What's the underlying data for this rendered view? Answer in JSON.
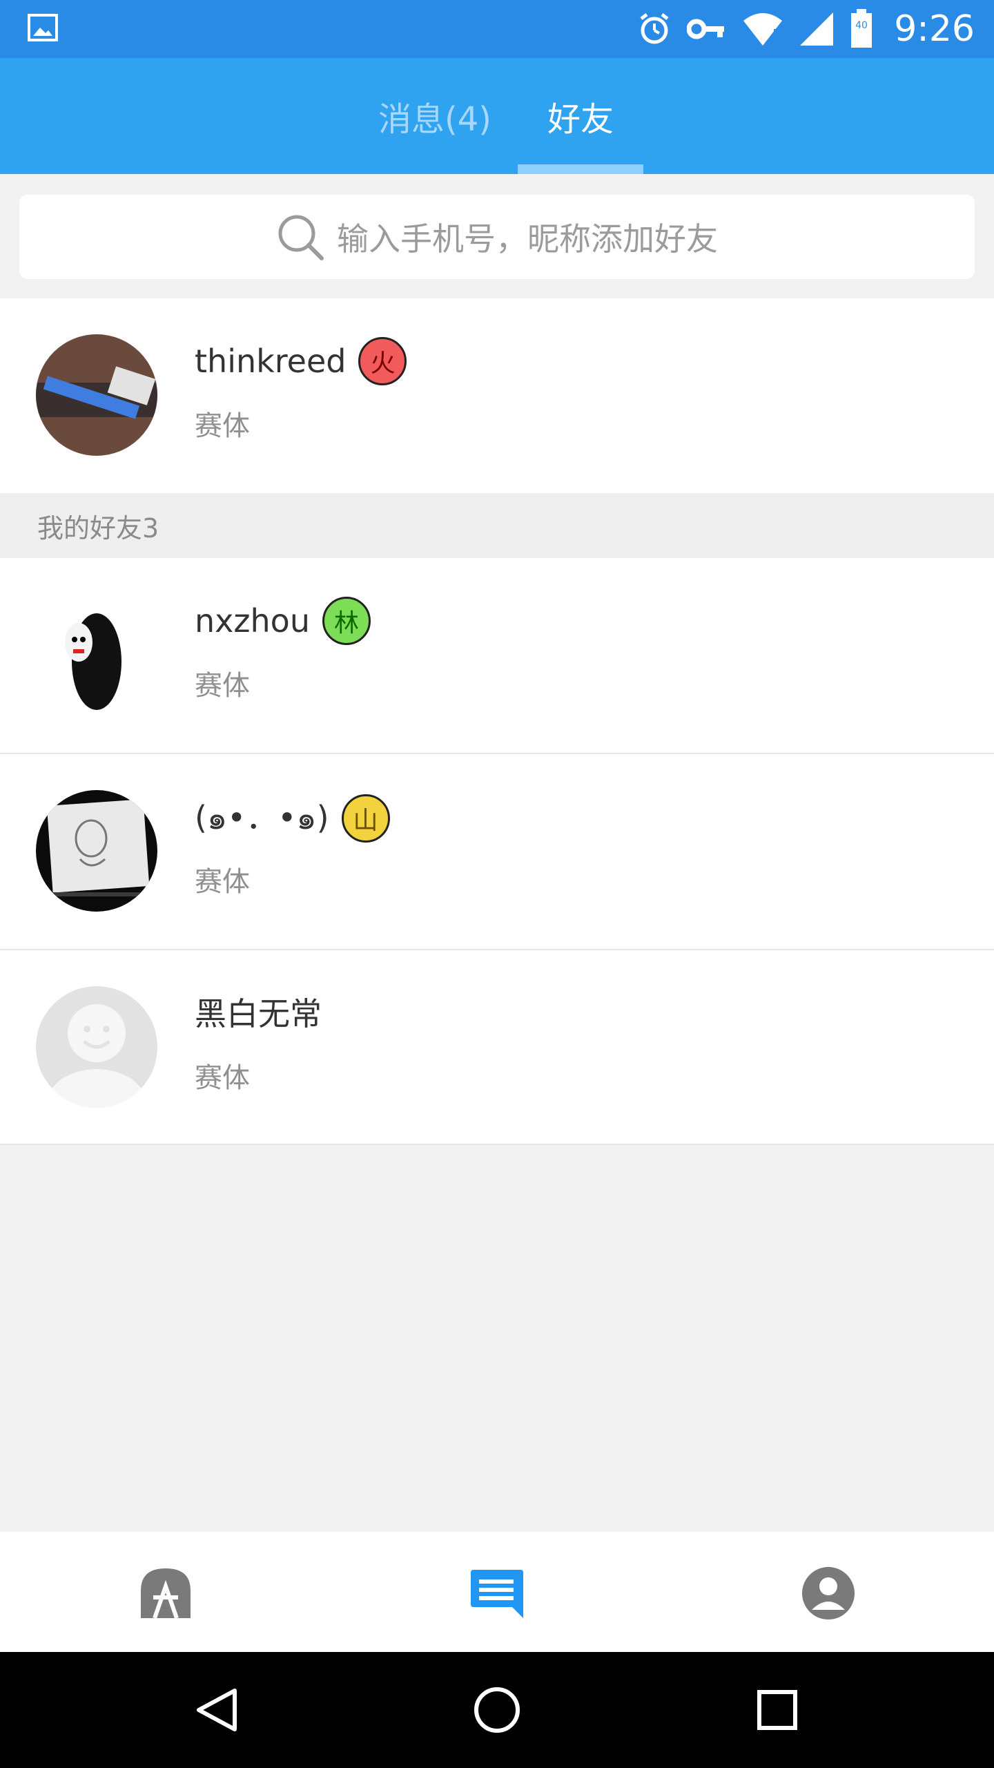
{
  "status_bar": {
    "time": "9:26",
    "battery_level": "40",
    "icons": [
      "image-icon",
      "alarm-icon",
      "vpn-key-icon",
      "wifi-icon",
      "signal-icon",
      "battery-icon"
    ]
  },
  "tabs": {
    "messages_label": "消息(4)",
    "friends_label": "好友",
    "active": "friends"
  },
  "search": {
    "placeholder": "输入手机号，昵称添加好友"
  },
  "top_contact": {
    "name": "thinkreed",
    "badge": "火",
    "badge_color": "#f15b5b",
    "subtitle": "赛体"
  },
  "friends_section": {
    "title": "我的好友3"
  },
  "friends": [
    {
      "name": "nxzhou",
      "badge": "林",
      "badge_color": "#7ddd57",
      "subtitle": "赛体"
    },
    {
      "name": "(๑•．•๑)",
      "badge": "山",
      "badge_color": "#f2d23d",
      "subtitle": "赛体"
    },
    {
      "name": "黑白无常",
      "subtitle": "赛体"
    }
  ],
  "colors": {
    "accent": "#2fa3ef",
    "status_bar": "#2a8be6",
    "bottom_active": "#2196f3",
    "bottom_inactive": "#7a7a7a"
  },
  "bottom_nav": {
    "items": [
      "home-icon",
      "messages-icon",
      "profile-icon"
    ],
    "active": "messages-icon"
  },
  "system_nav": {
    "items": [
      "back-icon",
      "home-circle-icon",
      "recents-icon"
    ]
  }
}
